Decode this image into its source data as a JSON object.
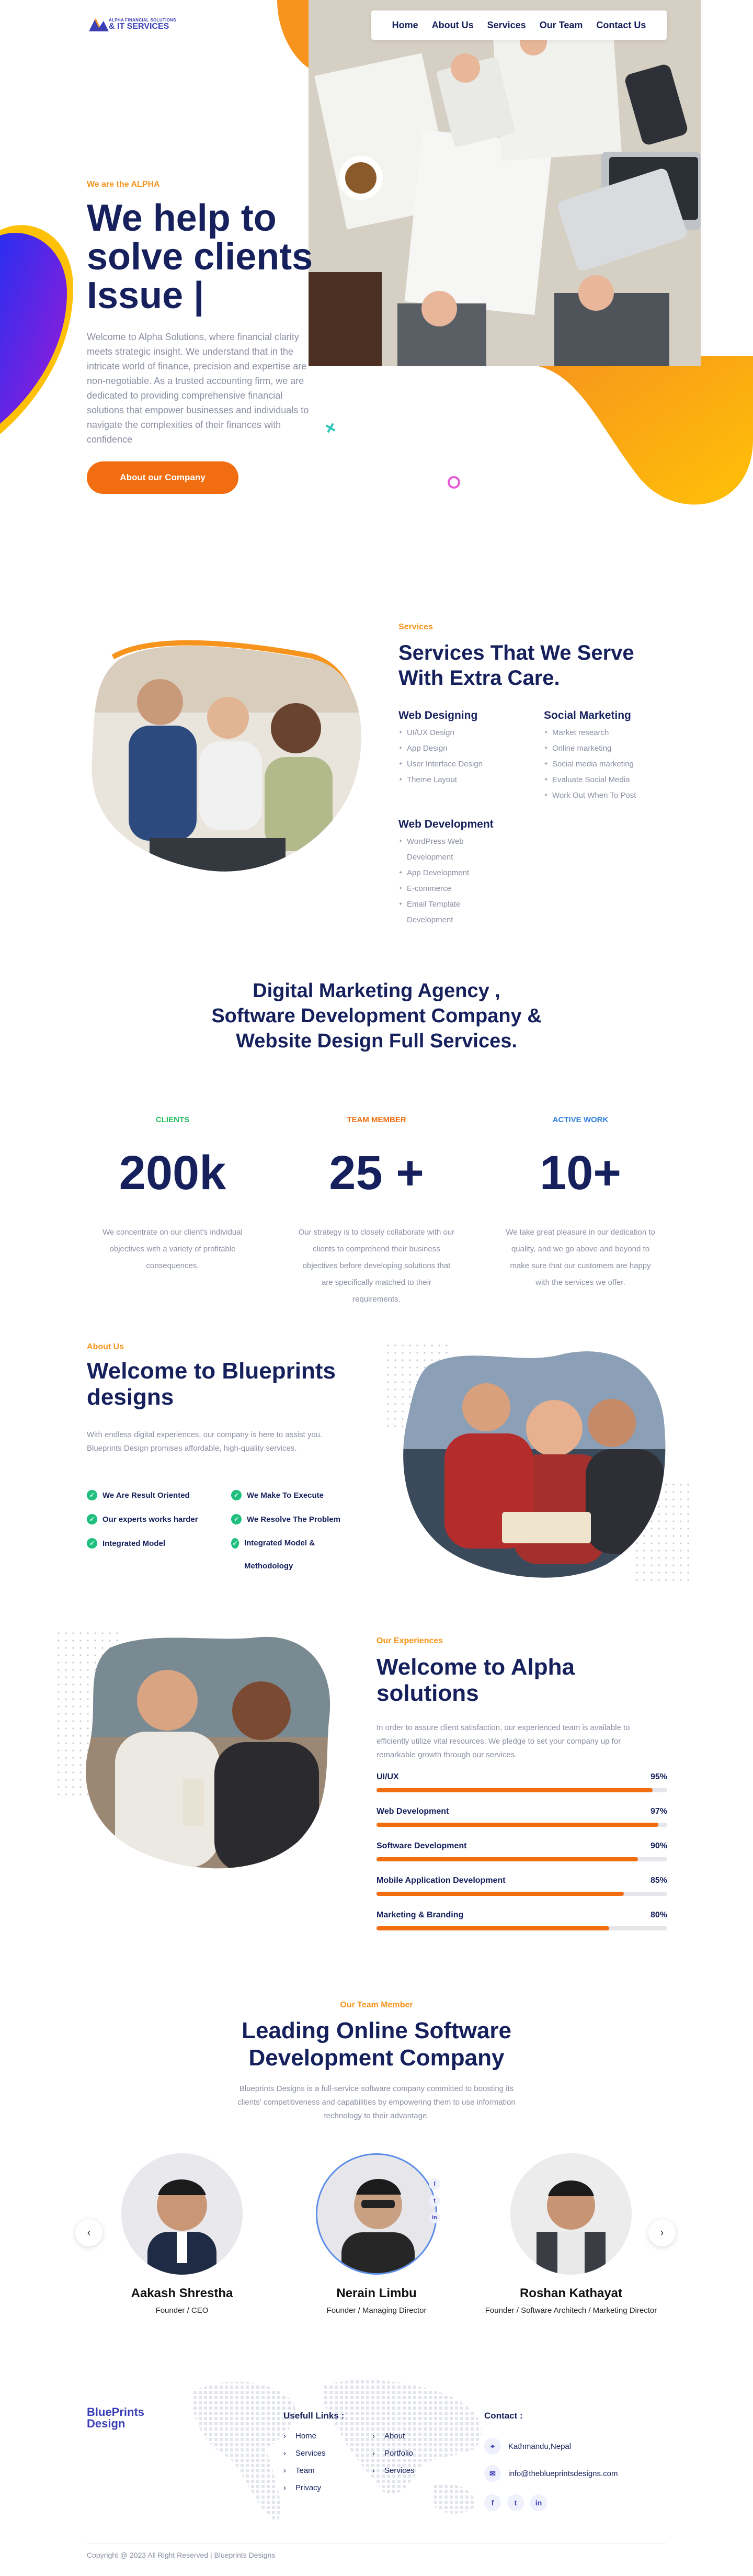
{
  "brand": {
    "logo_top": "ALPHA FINANCIAL SOLUTIONS",
    "logo_main": "& IT SERVICES",
    "accent": "#f26d0f",
    "navy": "#15205c",
    "purple": "#4b2bd6",
    "yellow": "#ffc107"
  },
  "nav": {
    "items": [
      "Home",
      "About Us",
      "Services",
      "Our Team",
      "Contact Us"
    ]
  },
  "hero": {
    "kicker": "We are the ALPHA",
    "title": "We help to solve clients Issue |",
    "description": "Welcome to Alpha Solutions, where financial clarity meets strategic insight. We understand that in the intricate world of finance, precision and expertise are non-negotiable. As a trusted accounting firm, we are dedicated to providing comprehensive financial solutions that empower businesses and individuals to navigate the complexities of their finances with confidence",
    "button": "About our Company"
  },
  "services": {
    "kicker": "Services",
    "title": "Services That We Serve With Extra Care.",
    "columns": [
      {
        "title": "Web Designing",
        "items": [
          "UI/UX Design",
          "App Design",
          "User Interface Design",
          "Theme Layout"
        ]
      },
      {
        "title": "Social Marketing",
        "items": [
          "Market research",
          "Online marketing",
          "Social media marketing",
          "Evaluate Social Media",
          "Work Out When To Post"
        ]
      },
      {
        "title": "Web Development",
        "items": [
          "WordPress Web Development",
          "App Development",
          "E-commerce",
          "Email Template Development"
        ]
      }
    ]
  },
  "agency": {
    "title": "Digital Marketing Agency , Software Development Company & Website Design Full Services."
  },
  "stats": [
    {
      "label": "CLIENTS",
      "color": "#1fbf5f",
      "number": "200k",
      "desc": "We concentrate on our client's individual objectives with a variety of profitable consequences."
    },
    {
      "label": "TEAM MEMBER",
      "color": "#f26d0f",
      "number": "25 +",
      "desc": "Our strategy is to closely collaborate with our clients to comprehend their business objectives before developing solutions that are specifically matched to their requirements."
    },
    {
      "label": "ACTIVE WORK",
      "color": "#2f7fe0",
      "number": "10+",
      "desc": "We take great pleasure in our dedication to quality, and we go above and beyond to make sure that our customers are happy with the services we offer."
    }
  ],
  "about": {
    "kicker": "About Us",
    "title": "Welcome to Blueprints designs",
    "description": "With endless digital experiences, our company is here to assist you. Blueprints Design promises affordable, high-quality services.",
    "checks": [
      "We Are Result Oriented",
      "We Make To Execute",
      "Our experts works harder",
      "We Resolve The Problem",
      "Integrated Model",
      "Integrated Model & Methodology"
    ]
  },
  "experience": {
    "kicker": "Our Experiences",
    "title": "Welcome to Alpha solutions",
    "description": "In order to assure client satisfaction, our experienced team is available to efficiently utilize vital resources. We pledge to set your company up for remarkable growth through our services.",
    "skills": [
      {
        "label": "UI/UX",
        "pct": "95%",
        "value": 95
      },
      {
        "label": "Web Development",
        "pct": "97%",
        "value": 97
      },
      {
        "label": "Software Development",
        "pct": "90%",
        "value": 90
      },
      {
        "label": "Mobile Application Development",
        "pct": "85%",
        "value": 85
      },
      {
        "label": "Marketing & Branding",
        "pct": "80%",
        "value": 80
      }
    ]
  },
  "team": {
    "kicker": "Our Team Member",
    "title": "Leading Online Software Development Company",
    "description": "Blueprints Designs is a full-service software company committed to boosting its clients' competitiveness and capabilities by empowering them to use information technology to their advantage.",
    "members": [
      {
        "name": "Aakash Shrestha",
        "role": "Founder / CEO"
      },
      {
        "name": "Nerain Limbu",
        "role": "Founder / Managing Director"
      },
      {
        "name": "Roshan Kathayat",
        "role": "Founder / Software Architech / Marketing Director"
      }
    ]
  },
  "footer": {
    "logo_line1": "BluePrints",
    "logo_line2": "Design",
    "links_title": "Usefull Links :",
    "links_col1": [
      "Home",
      "Services",
      "Team",
      "Privacy"
    ],
    "links_col2": [
      "About",
      "Portfolio",
      "Services"
    ],
    "contact_title": "Contact :",
    "address": "Kathmandu,Nepal",
    "email": "info@theblueprintsdesigns.com",
    "copyright": "Copyright @ 2023 All Right Reserved | Blueprints Designs"
  }
}
